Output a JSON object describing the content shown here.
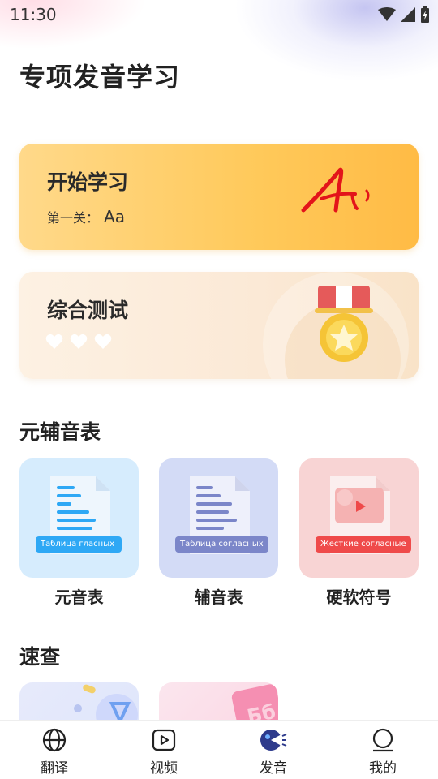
{
  "status": {
    "time": "11:30"
  },
  "page_title": "专项发音学习",
  "start_card": {
    "title": "开始学习",
    "level_prefix": "第一关：",
    "level_value": "Aa"
  },
  "test_card": {
    "title": "综合测试",
    "hearts": 3
  },
  "sections": {
    "table": "元辅音表",
    "quick": "速查"
  },
  "tiles": [
    {
      "label": "元音表",
      "tag": "Таблица гласных",
      "accent": "#2ea8f5",
      "bg": "#d6ecfd"
    },
    {
      "label": "辅音表",
      "tag": "Таблица согласных",
      "accent": "#7b86c9",
      "bg": "#d3dbf6"
    },
    {
      "label": "硬软符号",
      "tag": "Жесткие согласные",
      "accent": "#ef4a4a",
      "bg": "#f8d4d4"
    }
  ],
  "tabs": [
    {
      "label": "翻译",
      "icon": "globe-icon"
    },
    {
      "label": "视频",
      "icon": "video-play-icon"
    },
    {
      "label": "发音",
      "icon": "pronunciation-icon"
    },
    {
      "label": "我的",
      "icon": "profile-icon"
    }
  ]
}
